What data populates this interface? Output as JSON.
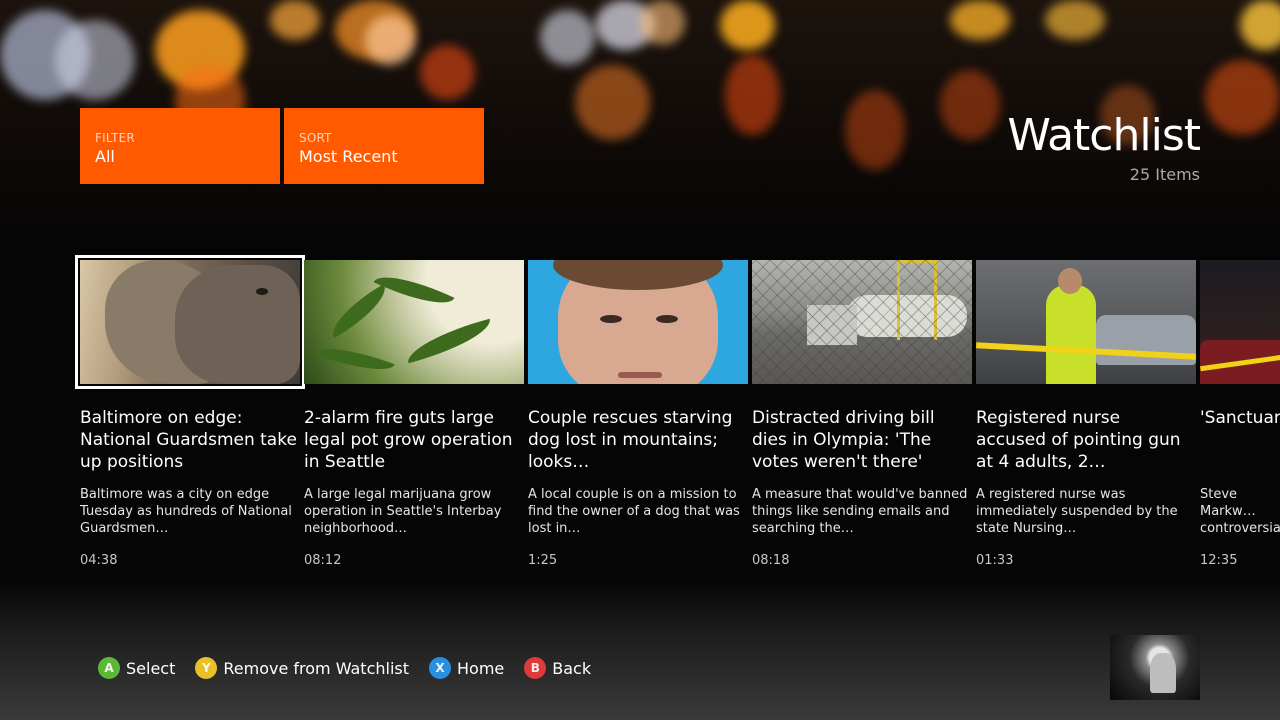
{
  "header": {
    "filter": {
      "caption": "FILTER",
      "value": "All"
    },
    "sort": {
      "caption": "SORT",
      "value": "Most Recent"
    },
    "title": "Watchlist",
    "count": "25 Items"
  },
  "cards": [
    {
      "title": "Baltimore on edge: National Guardsmen take up positions",
      "desc": "Baltimore was a city on edge Tuesday as hundreds of National Guardsmen…",
      "duration": "04:38",
      "thumb": "elephant-image",
      "focused": true
    },
    {
      "title": "2-alarm fire guts large legal pot grow operation in Seattle",
      "desc": "A large legal marijuana grow operation in Seattle's Interbay neighborhood…",
      "duration": "08:12",
      "thumb": "cannabis-plant-image"
    },
    {
      "title": "Couple rescues starving dog lost in mountains; looks…",
      "desc": "A local couple is on a mission to find the owner of a dog that was lost in…",
      "duration": "1:25",
      "thumb": "man-portrait-image"
    },
    {
      "title": "Distracted driving bill dies in Olympia: 'The votes weren't there'",
      "desc": "A measure that would've banned things like sending emails and searching the…",
      "duration": "08:18",
      "thumb": "tanker-truck-image"
    },
    {
      "title": "Registered nurse accused of pointing gun at 4 adults, 2…",
      "desc": "A registered nurse was immediately suspended by the state Nursing…",
      "duration": "01:33",
      "thumb": "police-scene-image"
    },
    {
      "title": "'Sanctuary' founder g… documen…",
      "desc": "Steve Markw… controversia… now-defunct…",
      "duration": "12:35",
      "thumb": "night-scene-image"
    }
  ],
  "hints": [
    {
      "key": "A",
      "label": "Select",
      "color": "#5db83a"
    },
    {
      "key": "Y",
      "label": "Remove from Watchlist",
      "color": "#e9c02a"
    },
    {
      "key": "X",
      "label": "Home",
      "color": "#2b8fe0"
    },
    {
      "key": "B",
      "label": "Back",
      "color": "#de3a3a"
    }
  ],
  "theme": {
    "accent": "#ff5a00",
    "focus": "#ffffff"
  }
}
